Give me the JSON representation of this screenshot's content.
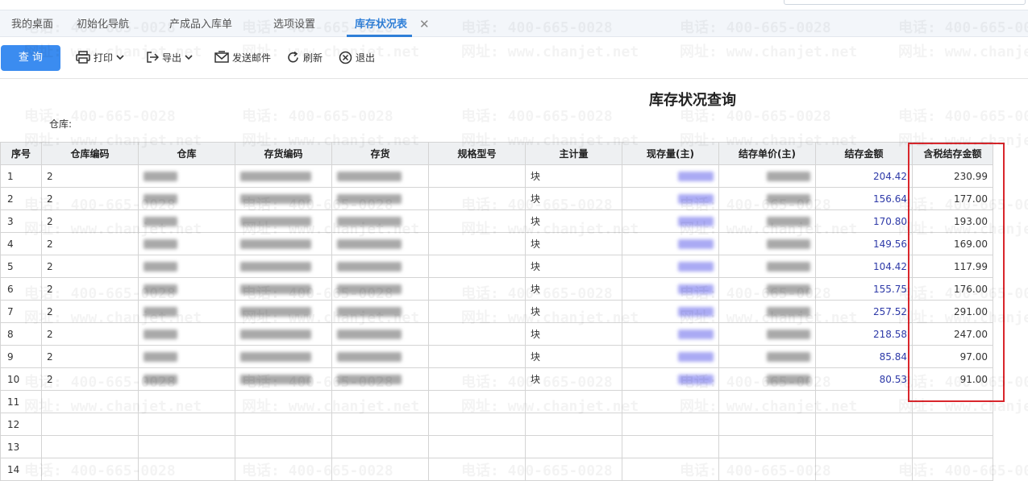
{
  "tabs": [
    {
      "label": "我的桌面"
    },
    {
      "label": "初始化导航"
    },
    {
      "label": "产成品入库单"
    },
    {
      "label": "选项设置"
    },
    {
      "label": "库存状况表"
    }
  ],
  "tab_close_glyph": "✕",
  "toolbar": {
    "query_label": "查 询",
    "print_label": "打印",
    "export_label": "导出",
    "email_label": "发送邮件",
    "refresh_label": "刷新",
    "exit_label": "退出"
  },
  "report": {
    "title": "库存状况查询",
    "warehouse_label": "仓库:"
  },
  "table": {
    "headers": [
      "序号",
      "仓库编码",
      "仓库",
      "存货编码",
      "存货",
      "规格型号",
      "主计量",
      "现存量(主)",
      "结存单价(主)",
      "结存金额",
      "含税结存金额"
    ],
    "rows": [
      {
        "no": "1",
        "wh_code": "2",
        "unit": "块",
        "amount": "204.42",
        "tax_amount": "230.99"
      },
      {
        "no": "2",
        "wh_code": "2",
        "unit": "块",
        "amount": "156.64",
        "tax_amount": "177.00"
      },
      {
        "no": "3",
        "wh_code": "2",
        "unit": "块",
        "amount": "170.80",
        "tax_amount": "193.00"
      },
      {
        "no": "4",
        "wh_code": "2",
        "unit": "块",
        "amount": "149.56",
        "tax_amount": "169.00"
      },
      {
        "no": "5",
        "wh_code": "2",
        "unit": "块",
        "amount": "104.42",
        "tax_amount": "117.99"
      },
      {
        "no": "6",
        "wh_code": "2",
        "unit": "块",
        "amount": "155.75",
        "tax_amount": "176.00"
      },
      {
        "no": "7",
        "wh_code": "2",
        "unit": "块",
        "amount": "257.52",
        "tax_amount": "291.00"
      },
      {
        "no": "8",
        "wh_code": "2",
        "unit": "块",
        "amount": "218.58",
        "tax_amount": "247.00"
      },
      {
        "no": "9",
        "wh_code": "2",
        "unit": "块",
        "amount": "85.84",
        "tax_amount": "97.00"
      },
      {
        "no": "10",
        "wh_code": "2",
        "unit": "块",
        "amount": "80.53",
        "tax_amount": "91.00"
      }
    ],
    "empty_rows": [
      "11",
      "12",
      "13",
      "14"
    ]
  },
  "watermark": {
    "phone": "电话: 400-665-0028",
    "site": "网址: www.chanjet.net"
  },
  "colors": {
    "accent": "#2f7fd8",
    "query_button": "#3b8cf0",
    "amount_text": "#2e3aa8",
    "highlight_frame": "#d9262c"
  },
  "icons": [
    "print-icon",
    "export-icon",
    "email-icon",
    "refresh-icon",
    "exit-icon",
    "chevron-down-icon"
  ]
}
